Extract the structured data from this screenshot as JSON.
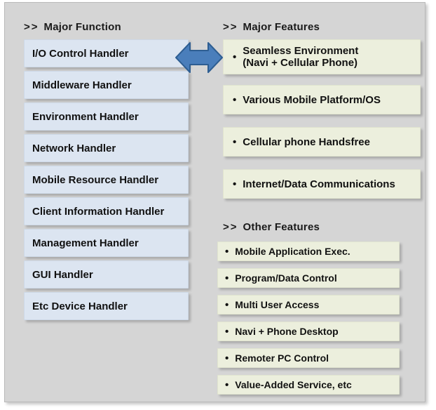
{
  "theme": {
    "panel_bg": "#d5d5d5",
    "left_box_bg": "#dce5f1",
    "right_box_bg": "#ecefdd",
    "arrow_fill": "#4a7ebb",
    "arrow_stroke": "#2e5e92",
    "text_color": "#111111"
  },
  "left_column": {
    "header": {
      "chevron": ">>",
      "label": "Major Function"
    },
    "items": [
      {
        "label": "I/O Control Handler"
      },
      {
        "label": "Middleware Handler"
      },
      {
        "label": "Environment Handler"
      },
      {
        "label": "Network Handler"
      },
      {
        "label": "Mobile Resource Handler"
      },
      {
        "label": "Client Information Handler"
      },
      {
        "label": "Management Handler"
      },
      {
        "label": "GUI Handler"
      },
      {
        "label": "Etc Device Handler"
      }
    ]
  },
  "right_column": {
    "major_features": {
      "header": {
        "chevron": ">>",
        "label": "Major Features"
      },
      "bullet": "•",
      "items": [
        {
          "line1": "Seamless Environment",
          "line2": "(Navi + Cellular Phone)"
        },
        {
          "line1": "Various Mobile Platform/OS",
          "line2": ""
        },
        {
          "line1": "Cellular phone Handsfree",
          "line2": ""
        },
        {
          "line1": "Internet/Data Communications",
          "line2": ""
        }
      ]
    },
    "other_features": {
      "header": {
        "chevron": ">>",
        "label": "Other Features"
      },
      "bullet": "•",
      "items": [
        {
          "label": "Mobile Application Exec."
        },
        {
          "label": "Program/Data Control"
        },
        {
          "label": "Multi User Access"
        },
        {
          "label": "Navi +  Phone Desktop"
        },
        {
          "label": "Remoter PC Control"
        },
        {
          "label": "Value-Added Service, etc"
        }
      ]
    }
  },
  "connector": {
    "name": "double-headed-arrow"
  }
}
